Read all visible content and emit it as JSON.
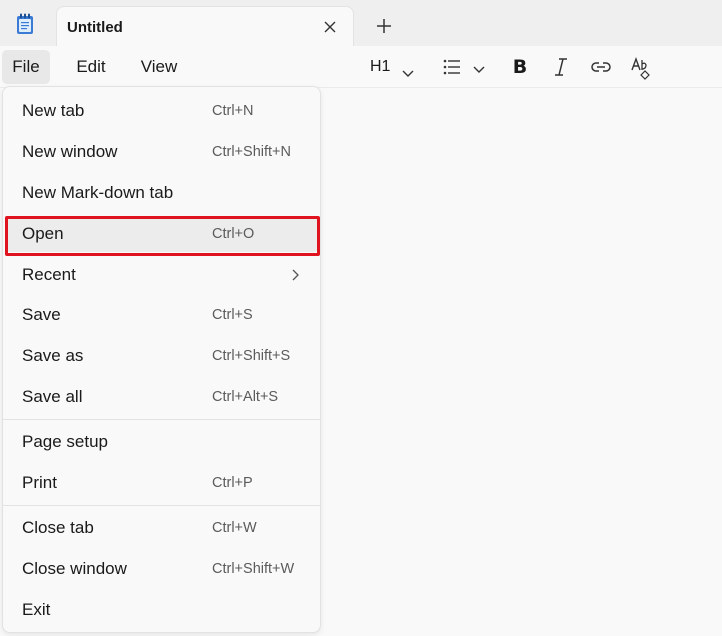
{
  "app": {
    "icon": "notepad-icon",
    "tab_title": "Untitled",
    "close_icon": "close-icon",
    "new_tab_icon": "plus-icon"
  },
  "menubar": {
    "file": "File",
    "edit": "Edit",
    "view": "View"
  },
  "toolbar": {
    "heading_label": "H1",
    "heading_icon": "chevron-down-icon",
    "list_icon": "bulleted-list-icon",
    "bold_label": "B",
    "italic_icon": "italic-icon",
    "link_icon": "link-icon",
    "spell_icon": "spellcheck-icon"
  },
  "file_menu": {
    "items": [
      {
        "label": "New tab",
        "shortcut": "Ctrl+N"
      },
      {
        "label": "New window",
        "shortcut": "Ctrl+Shift+N"
      },
      {
        "label": "New Mark-down tab",
        "shortcut": ""
      },
      {
        "label": "Open",
        "shortcut": "Ctrl+O",
        "highlighted": true
      },
      {
        "label": "Recent",
        "shortcut": "",
        "submenu": true
      },
      {
        "label": "Save",
        "shortcut": "Ctrl+S"
      },
      {
        "label": "Save as",
        "shortcut": "Ctrl+Shift+S"
      },
      {
        "label": "Save all",
        "shortcut": "Ctrl+Alt+S"
      },
      {
        "label": "Page setup",
        "shortcut": ""
      },
      {
        "label": "Print",
        "shortcut": "Ctrl+P"
      },
      {
        "label": "Close tab",
        "shortcut": "Ctrl+W"
      },
      {
        "label": "Close window",
        "shortcut": "Ctrl+Shift+W"
      },
      {
        "label": "Exit",
        "shortcut": ""
      }
    ],
    "highlight_color": "#e0141e"
  }
}
